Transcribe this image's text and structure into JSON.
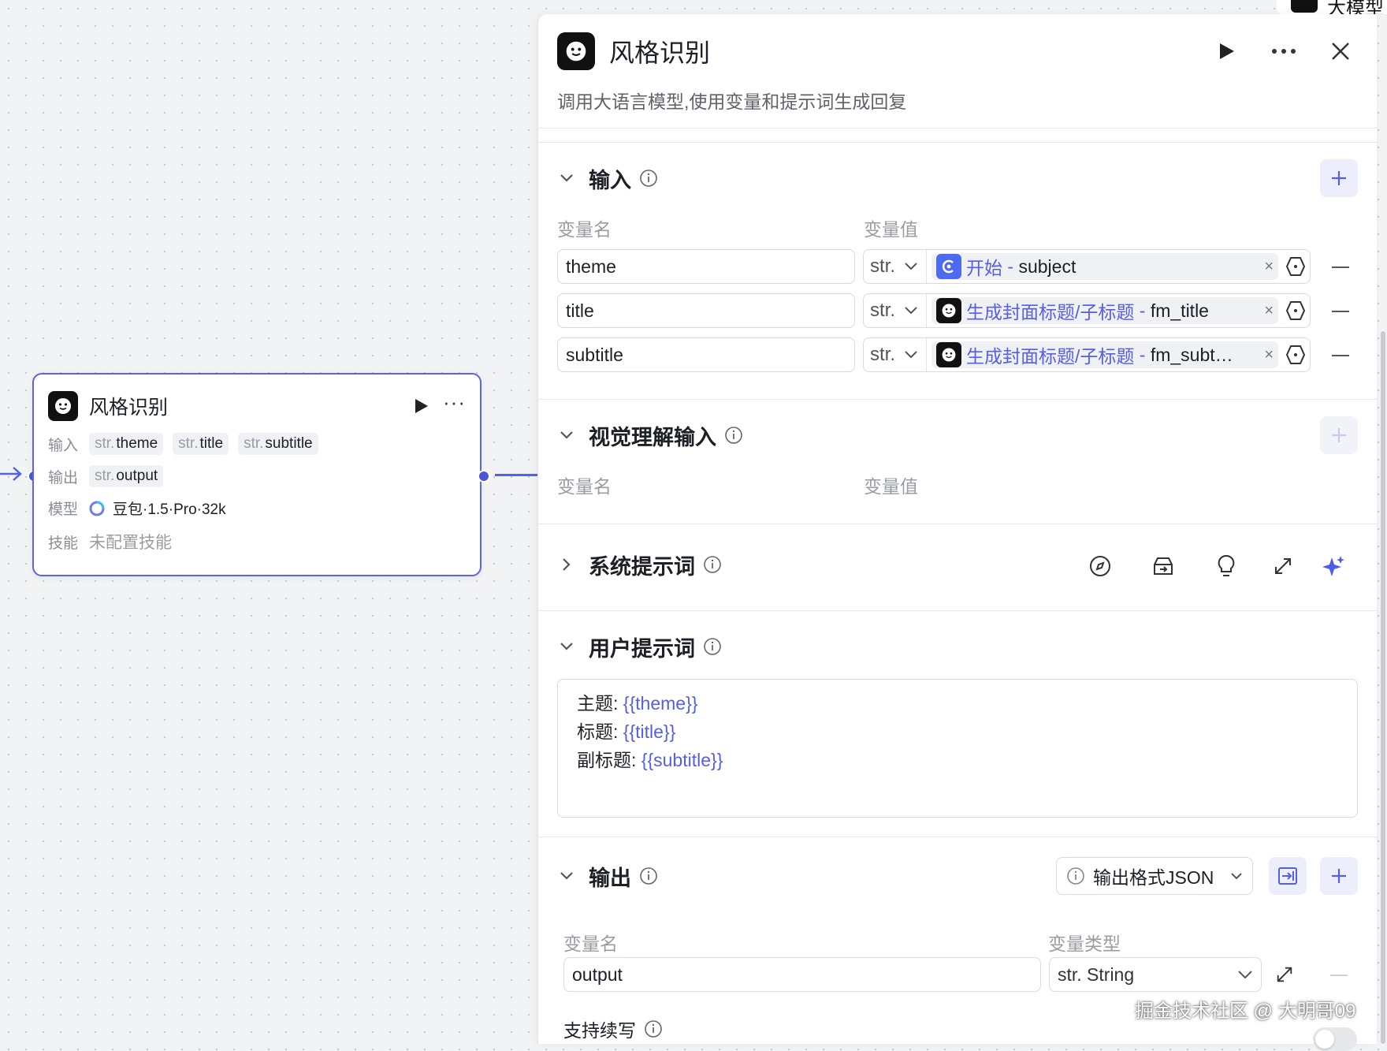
{
  "canvas": {
    "node": {
      "title": "风格识别",
      "inputs_label": "输入",
      "inputs": [
        {
          "type": "str.",
          "name": "theme"
        },
        {
          "type": "str.",
          "name": "title"
        },
        {
          "type": "str.",
          "name": "subtitle"
        }
      ],
      "outputs_label": "输出",
      "outputs": [
        {
          "type": "str.",
          "name": "output"
        }
      ],
      "model_label": "模型",
      "model_value": "豆包·1.5·Pro·32k",
      "skills_label": "技能",
      "skills_value": "未配置技能"
    }
  },
  "top_peek_text": "大模型",
  "panel": {
    "title": "风格识别",
    "description": "调用大语言模型,使用变量和提示词生成回复",
    "input_section": {
      "title": "输入",
      "col_name": "变量名",
      "col_value": "变量值",
      "rows": [
        {
          "name": "theme",
          "type": "str.",
          "source": "开始",
          "field": "subject",
          "source_icon": "start-node-icon"
        },
        {
          "name": "title",
          "type": "str.",
          "source": "生成封面标题/子标题",
          "field": "fm_title",
          "source_icon": "llm-node-icon"
        },
        {
          "name": "subtitle",
          "type": "str.",
          "source": "生成封面标题/子标题",
          "field": "fm_subt…",
          "source_icon": "llm-node-icon"
        }
      ],
      "separator": " - ",
      "clear_glyph": "×"
    },
    "vision_section": {
      "title": "视觉理解输入",
      "col_name": "变量名",
      "col_value": "变量值"
    },
    "system_prompt_section": {
      "title": "系统提示词"
    },
    "user_prompt_section": {
      "title": "用户提示词",
      "lines": [
        {
          "label": "主题:",
          "var": "{{theme}}"
        },
        {
          "label": "标题:",
          "var": "{{title}}"
        },
        {
          "label": "副标题:",
          "var": "{{subtitle}}"
        }
      ]
    },
    "output_section": {
      "title": "输出",
      "format_button": "输出格式JSON",
      "col_name": "变量名",
      "col_type": "变量类型",
      "rows": [
        {
          "name": "output",
          "type": "str. String"
        }
      ],
      "continue_label": "支持续写",
      "continue_enabled": false
    }
  },
  "watermark": "掘金技术社区 @ 大明哥09",
  "colors": {
    "accent": "#5560df",
    "node_border": "#5b63e6",
    "start_icon": "#4d6bf0"
  }
}
